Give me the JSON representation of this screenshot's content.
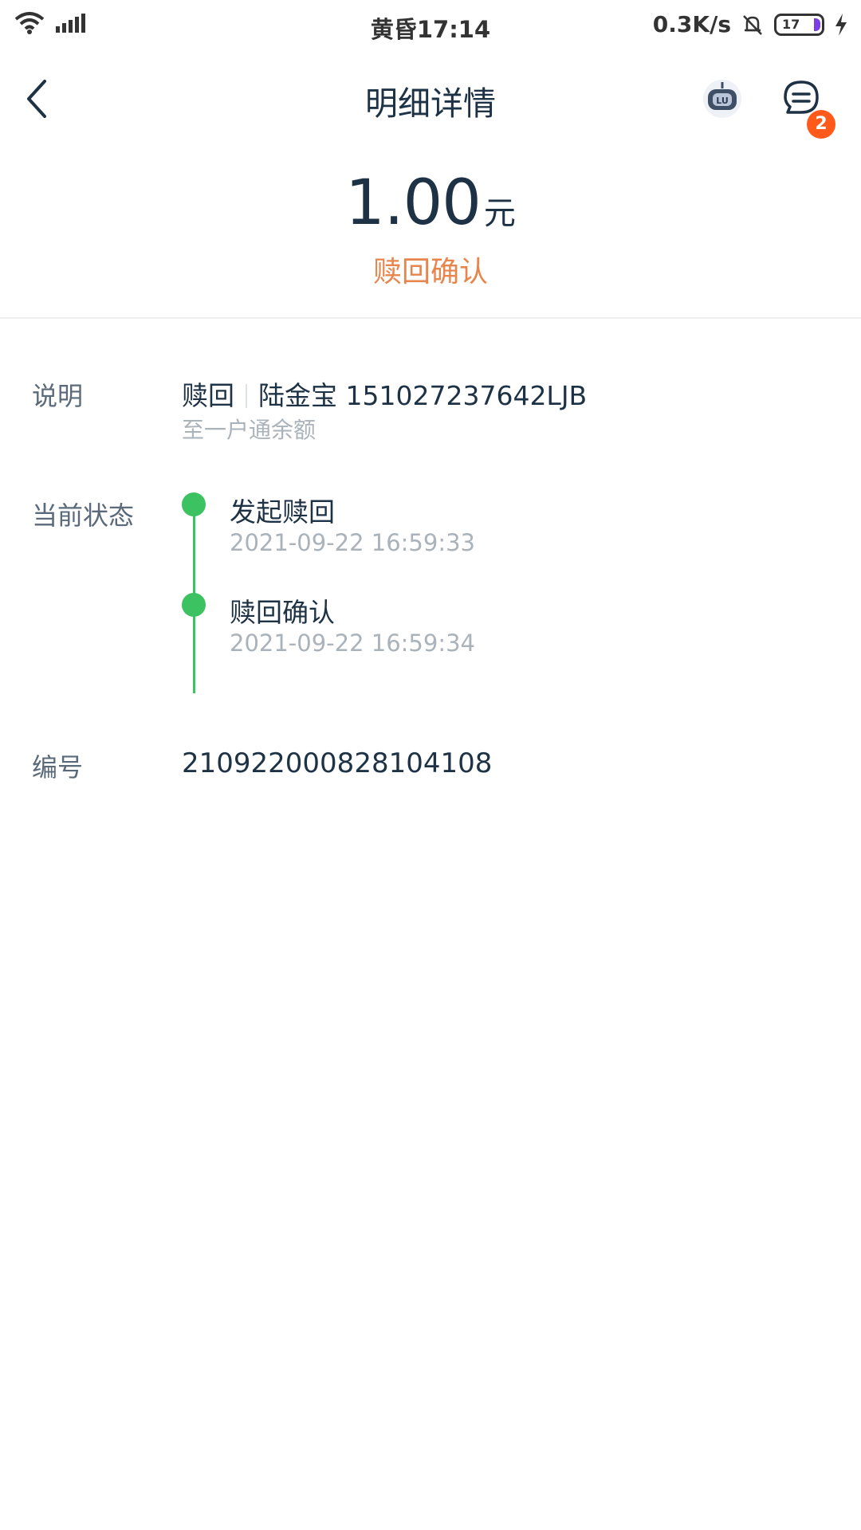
{
  "status_bar": {
    "time": "黄昏17:14",
    "speed": "0.3K/s",
    "battery": "17",
    "icons": [
      "wifi-icon",
      "signal-icon",
      "mute-bell-icon",
      "battery-icon",
      "charging-icon"
    ]
  },
  "nav": {
    "title": "明细详情",
    "badge_count": "2",
    "icons": [
      "back-arrow-icon",
      "robot-icon",
      "message-icon"
    ]
  },
  "summary": {
    "amount": "1.00",
    "unit": "元",
    "status": "赎回确认"
  },
  "details": {
    "description_label": "说明",
    "description_type": "赎回",
    "description_product": "陆金宝 151027237642LJB",
    "description_sub": "至一户通余额",
    "status_label": "当前状态",
    "timeline": [
      {
        "title": "发起赎回",
        "time": "2021-09-22 16:59:33"
      },
      {
        "title": "赎回确认",
        "time": "2021-09-22 16:59:34"
      }
    ],
    "number_label": "编号",
    "number_value": "210922000828104108"
  },
  "colors": {
    "accent_orange": "#e8854d",
    "timeline_green": "#3cc261",
    "badge_orange": "#ff5a1a",
    "title_text": "#1e3246"
  }
}
